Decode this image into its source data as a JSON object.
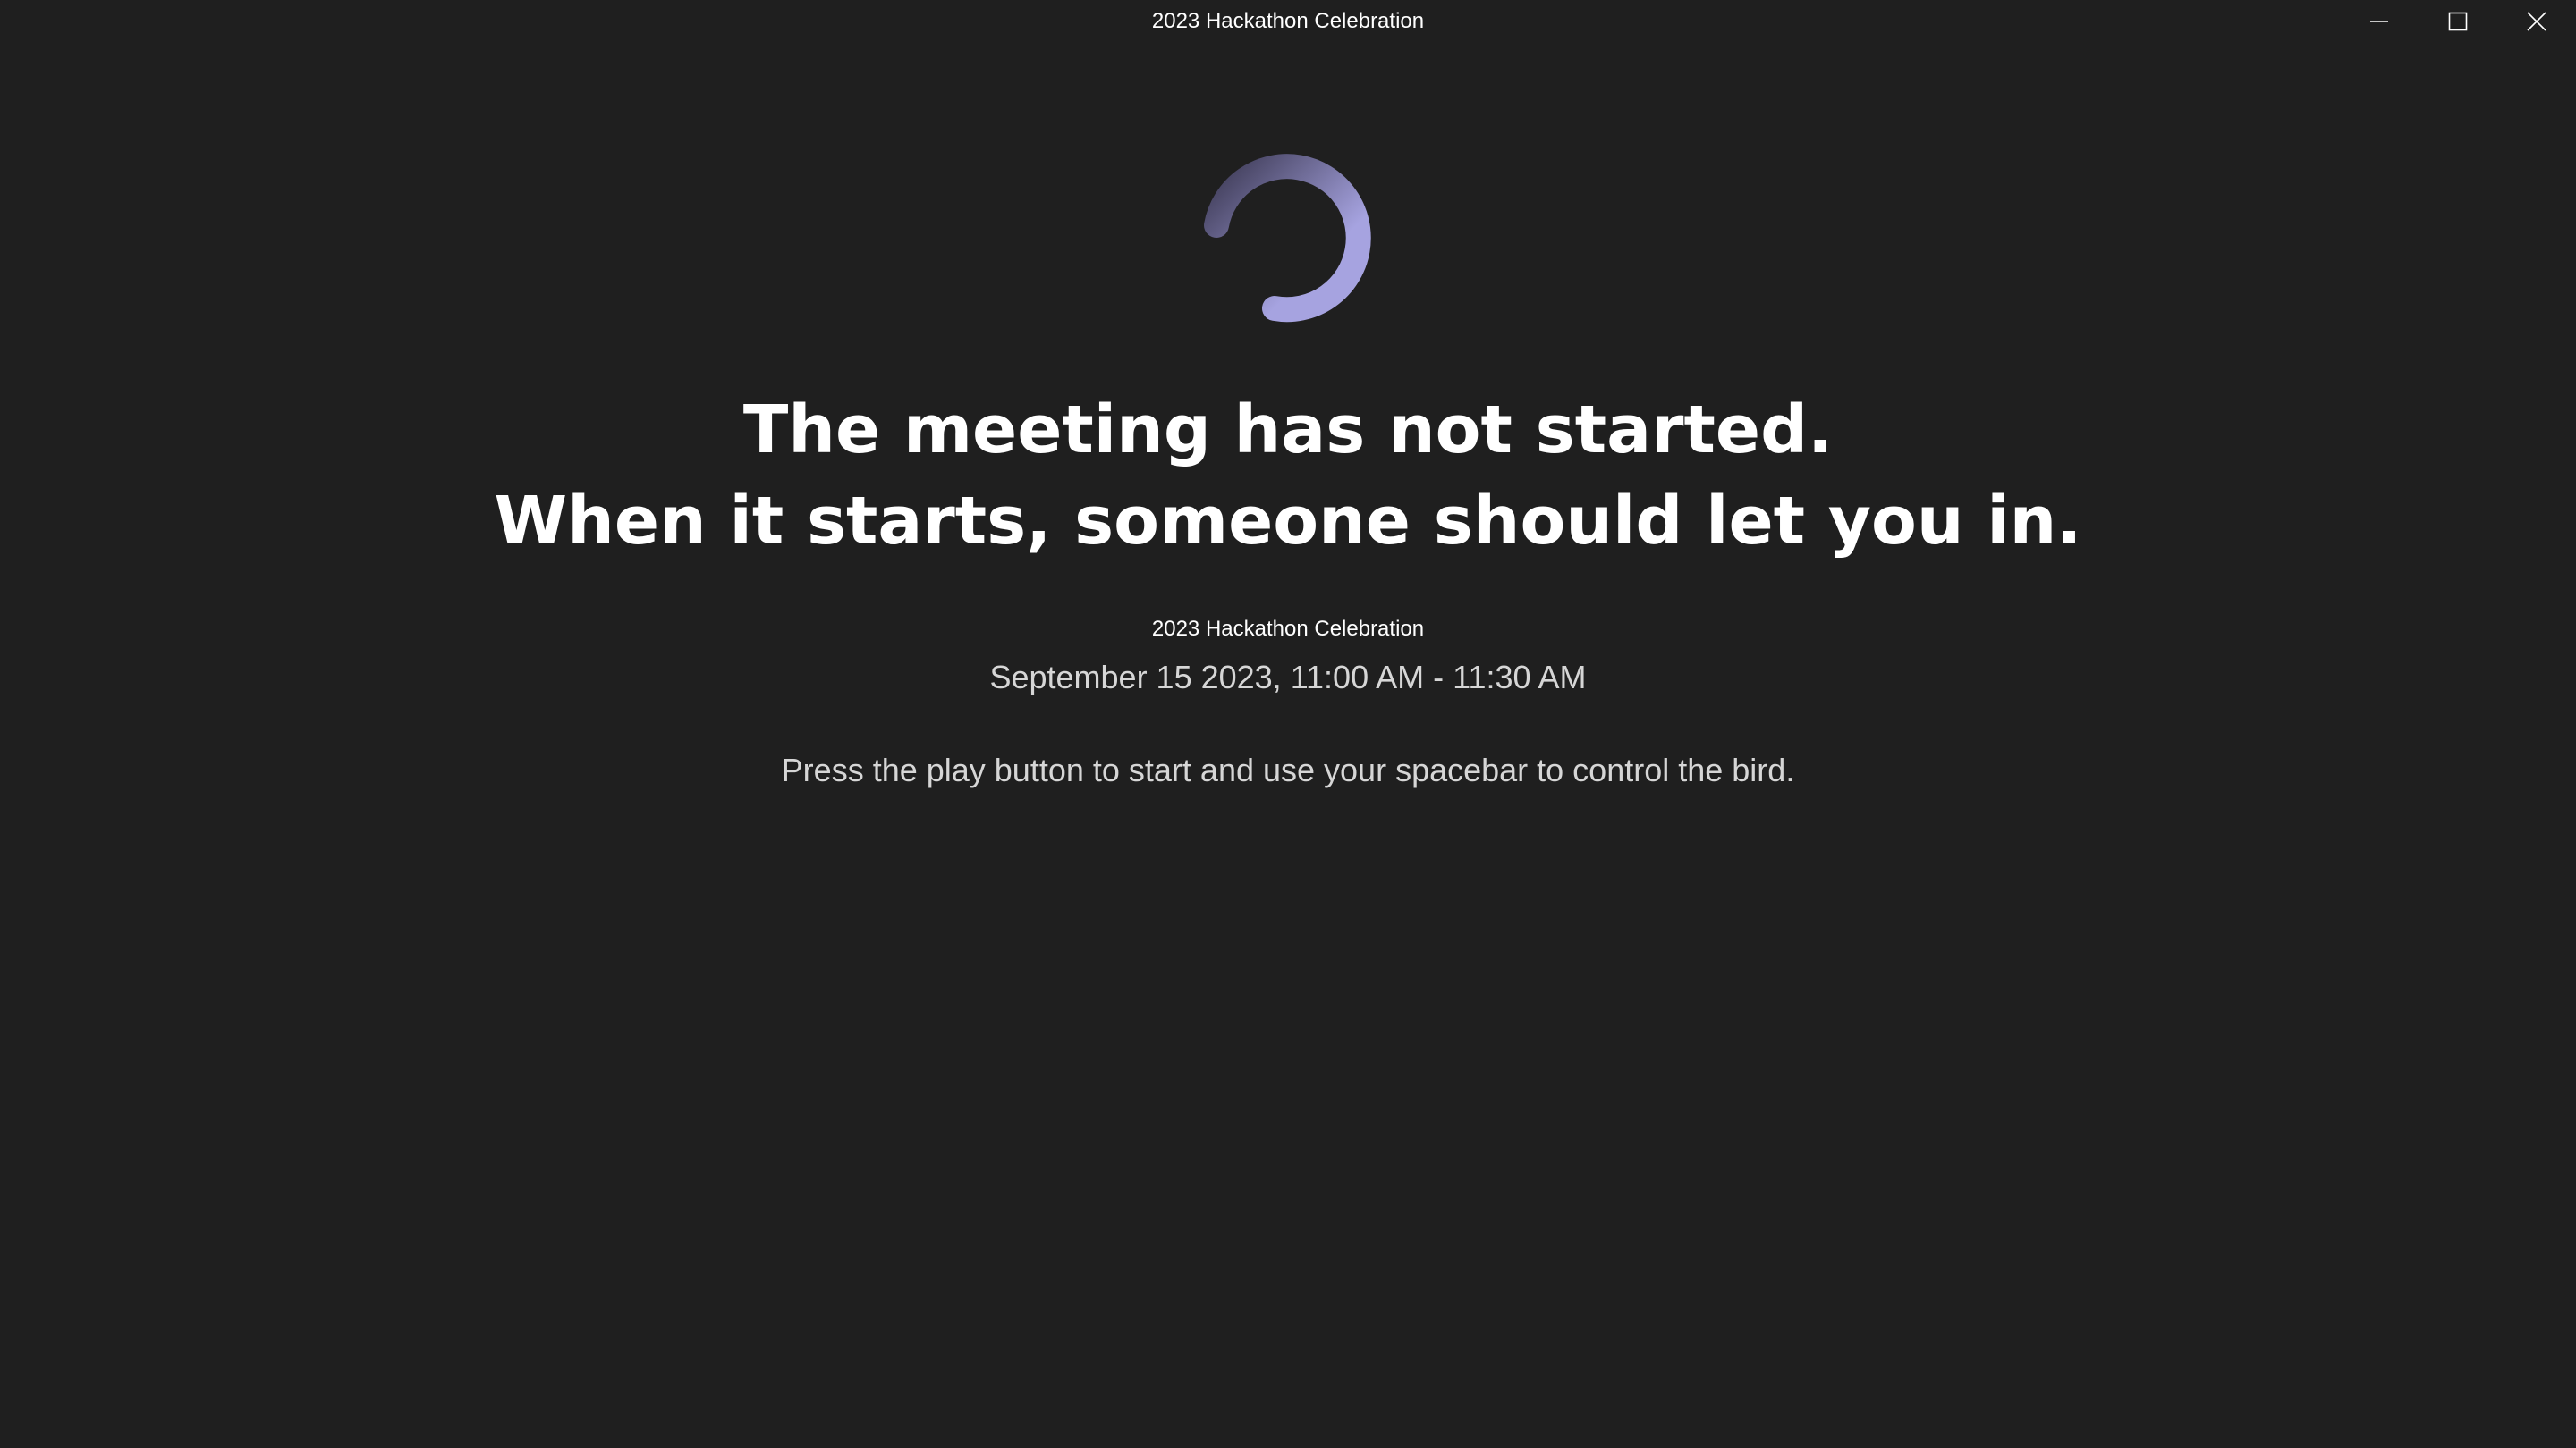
{
  "window": {
    "title": "2023 Hackathon Celebration",
    "controls": {
      "minimize_icon": "minimize-icon",
      "maximize_icon": "maximize-icon",
      "close_icon": "close-icon"
    }
  },
  "lobby": {
    "spinner_icon": "loading-spinner-icon",
    "spinner_colors": [
      "#3d3a55",
      "#a6a3e0"
    ],
    "headline_line1": "The meeting has not started.",
    "headline_line2": "When it starts, someone should let you in.",
    "meeting_title": "2023 Hackathon Celebration",
    "meeting_time": "September 15 2023, 11:00 AM - 11:30 AM",
    "instructions": "Press the play button to start and use your spacebar to control the bird."
  },
  "colors": {
    "background": "#1f1f1f",
    "text_primary": "#ffffff",
    "text_secondary": "#d6d6d6"
  }
}
